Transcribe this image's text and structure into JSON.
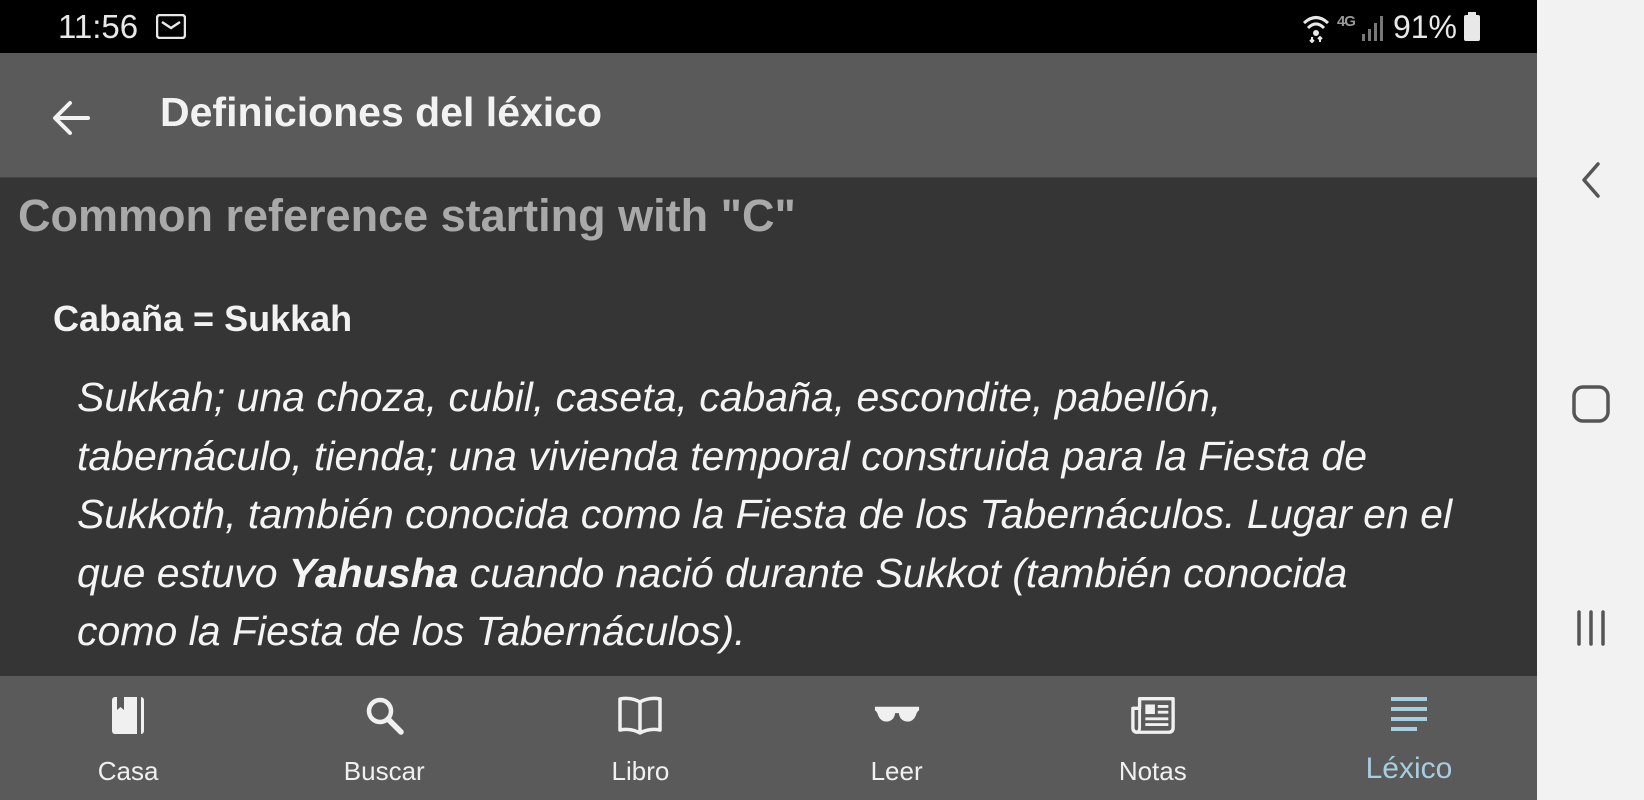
{
  "status_bar": {
    "time": "11:56",
    "network_label": "4G",
    "battery": "91%"
  },
  "app_bar": {
    "title": "Definiciones del léxico"
  },
  "content": {
    "section_heading": "Common reference starting with \"C\"",
    "entry_term": "Cabaña = Sukkah",
    "definition_part1": "Sukkah; una choza, cubil, caseta, cabaña, escondite, pabellón, tabernáculo, tienda; una vivienda temporal construida para la Fiesta de Sukkoth, también conocida como la Fiesta de los Tabernáculos. Lugar en el que estuvo ",
    "definition_bold": "Yahusha",
    "definition_part2": " cuando nació durante Sukkot (también conocida como la Fiesta de los Tabernáculos)."
  },
  "bottom_nav": {
    "items": [
      {
        "label": "Casa",
        "icon": "book-icon"
      },
      {
        "label": "Buscar",
        "icon": "search-icon"
      },
      {
        "label": "Libro",
        "icon": "open-book-icon"
      },
      {
        "label": "Leer",
        "icon": "glasses-icon"
      },
      {
        "label": "Notas",
        "icon": "newspaper-icon"
      },
      {
        "label": "Léxico",
        "icon": "lines-icon"
      }
    ],
    "active_index": 5
  },
  "colors": {
    "app_bar": "#5a5a5a",
    "content_bg": "#353535",
    "active_accent": "#a8cde0"
  }
}
